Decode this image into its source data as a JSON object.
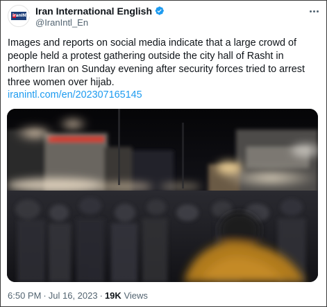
{
  "account": {
    "display_name": "Iran International English",
    "handle": "@IranIntl_En",
    "avatar_text": "iranINTL",
    "verified": true
  },
  "tweet": {
    "text": "Images and reports on social media indicate that a large crowd of people held a protest gathering outside the city hall of Rasht in northern Iran on Sunday evening after security forces tried to arrest three women over hijab.",
    "link": "iranintl.com/en/202307165145"
  },
  "meta": {
    "time": "6:50 PM",
    "date": "Jul 16, 2023",
    "separator": "·",
    "views_count": "19K",
    "views_label": "Views"
  },
  "icons": {
    "verified": "verified-badge-icon",
    "more": "more-options-icon"
  },
  "colors": {
    "verified_badge": "#1d9bf0",
    "link": "#1d9bf0",
    "secondary_text": "#536471",
    "primary_text": "#0f1419"
  }
}
